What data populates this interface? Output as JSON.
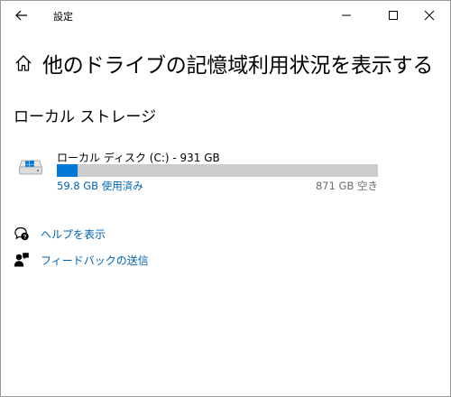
{
  "window": {
    "title": "設定"
  },
  "header": {
    "title": "他のドライブの記憶域利用状況を表示する"
  },
  "local_storage": {
    "section_title": "ローカル ストレージ",
    "drives": [
      {
        "name": "ローカル ディスク (C:) - 931 GB",
        "used_label": "59.8 GB 使用済み",
        "free_label": "871 GB 空き",
        "used_fraction": 0.064
      }
    ]
  },
  "links": {
    "help": "ヘルプを表示",
    "feedback": "フィードバックの送信"
  },
  "colors": {
    "accent": "#0078d7",
    "link": "#0063b1",
    "bar_track": "#cccccc"
  }
}
